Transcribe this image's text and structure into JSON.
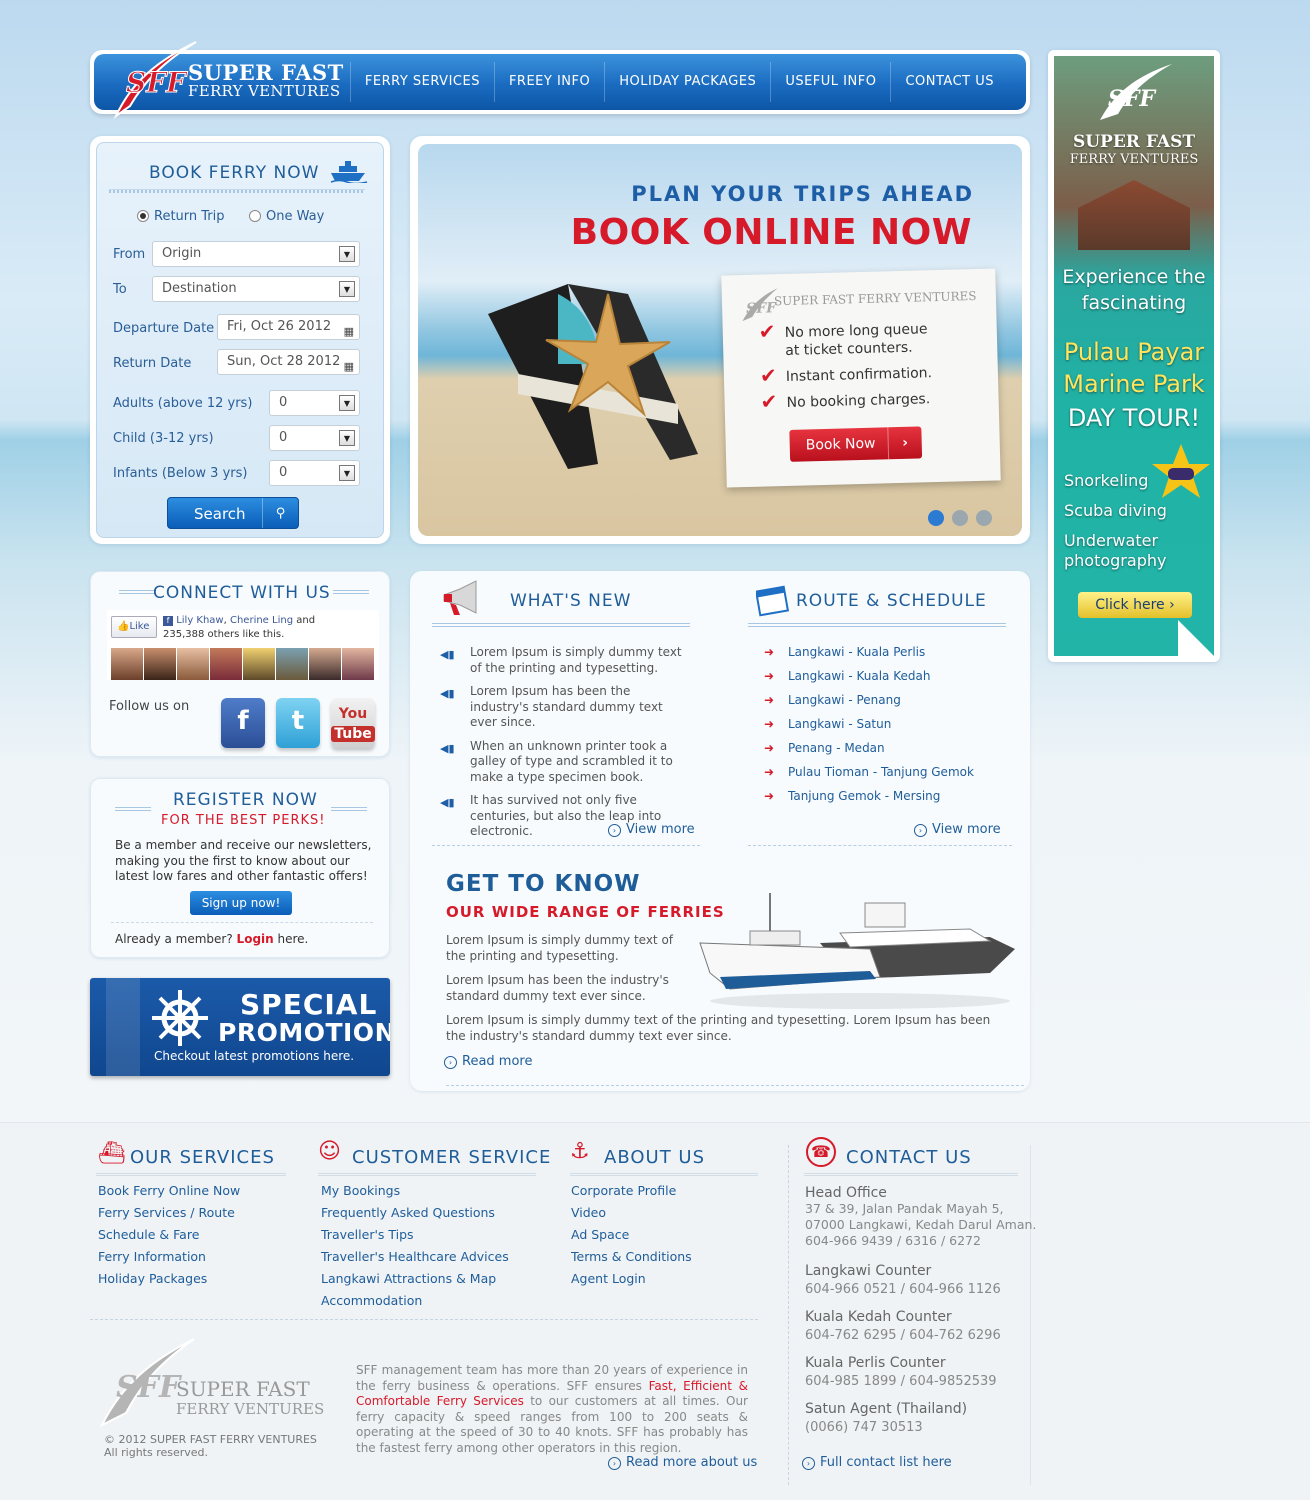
{
  "header": {
    "logo_mark": "SFF",
    "brand_line1": "SUPER FAST",
    "brand_line2": "FERRY VENTURES",
    "nav": [
      "FERRY SERVICES",
      "FREEY INFO",
      "HOLIDAY PACKAGES",
      "USEFUL INFO",
      "CONTACT US"
    ]
  },
  "booking": {
    "title": "BOOK FERRY NOW",
    "trip_type": {
      "return": "Return Trip",
      "oneway": "One Way",
      "selected": "return"
    },
    "from_label": "From",
    "from_value": "Origin",
    "to_label": "To",
    "to_value": "Destination",
    "departure_label": "Departure Date",
    "departure_value": "Fri, Oct 26 2012",
    "return_label": "Return Date",
    "return_value": "Sun, Oct 28 2012",
    "adults_label": "Adults (above 12 yrs)",
    "adults_value": "0",
    "child_label": "Child (3-12 yrs)",
    "child_value": "0",
    "infants_label": "Infants (Below 3 yrs)",
    "infants_value": "0",
    "search_label": "Search"
  },
  "hero": {
    "subtitle": "PLAN YOUR TRIPS AHEAD",
    "title": "BOOK ONLINE NOW",
    "card_brand": "SUPER FAST FERRY VENTURES",
    "card_mark": "SFF",
    "points": [
      "No more long queue at ticket counters.",
      "Instant confirmation.",
      "No booking charges."
    ],
    "button": "Book Now",
    "slides": 3,
    "active_slide": 1
  },
  "side_banner": {
    "brand_mark": "SFF",
    "brand_line1": "SUPER FAST",
    "brand_line2": "FERRY VENTURES",
    "line1": "Experience the",
    "line2": "fascinating",
    "line3": "Pulau Payar",
    "line4": "Marine Park",
    "line5": "DAY TOUR!",
    "activities": [
      "Snorkeling",
      "Scuba diving",
      "Underwater",
      "photography"
    ],
    "button": "Click here"
  },
  "connect": {
    "title": "CONNECT WITH US",
    "like": "Like",
    "fb_name1": "Lily Khaw",
    "fb_name2": "Cherine Ling",
    "fb_and": "and",
    "fb_text": "235,388 others like this.",
    "follow": "Follow us on"
  },
  "register": {
    "title": "REGISTER NOW",
    "subtitle": "FOR THE BEST PERKS!",
    "body": "Be a member and receive our newsletters, making you the first to know about our latest low fares and other fantastic offers!",
    "button": "Sign up now!",
    "member_text": "Already a member?",
    "login": "Login",
    "here": "here."
  },
  "promo": {
    "line1": "SPECIAL",
    "line2": "PROMOTION",
    "line3": "Checkout latest promotions here."
  },
  "whats_new": {
    "title": "WHAT'S NEW",
    "items": [
      "Lorem Ipsum is simply dummy text of the printing and typesetting.",
      "Lorem Ipsum has been the industry's standard dummy text ever since.",
      "When an unknown printer took a galley of type and scrambled it to make a type specimen book.",
      "It has survived not only five centuries, but also the leap into electronic."
    ],
    "view_more": "View more"
  },
  "route": {
    "title": "ROUTE & SCHEDULE",
    "items": [
      "Langkawi - Kuala Perlis",
      "Langkawi - Kuala Kedah",
      "Langkawi - Penang",
      "Langkawi - Satun",
      "Penang - Medan",
      "Pulau Tioman - Tanjung Gemok",
      "Tanjung Gemok - Mersing"
    ],
    "view_more": "View more"
  },
  "get_to_know": {
    "title": "GET TO KNOW",
    "subtitle": "OUR WIDE RANGE OF FERRIES",
    "p1": "Lorem Ipsum is simply dummy text of the printing and typesetting.",
    "p2": "Lorem Ipsum has been the industry's standard dummy text ever since.",
    "p3": "Lorem Ipsum is simply dummy text of the printing and typesetting. Lorem Ipsum has been the industry's standard dummy text ever since.",
    "read_more": "Read more"
  },
  "footer": {
    "services": {
      "title": "OUR SERVICES",
      "items": [
        "Book Ferry Online Now",
        "Ferry Services / Route",
        "Schedule & Fare",
        "Ferry Information",
        "Holiday Packages"
      ]
    },
    "customer": {
      "title": "CUSTOMER SERVICE",
      "items": [
        "My Bookings",
        "Frequently Asked Questions",
        "Traveller's Tips",
        "Traveller's Healthcare Advices",
        "Langkawi Attractions & Map",
        "Accommodation"
      ]
    },
    "about": {
      "title": "ABOUT US",
      "items": [
        "Corporate Profile",
        "Video",
        "Ad Space",
        "Terms & Conditions",
        "Agent Login"
      ]
    },
    "contact": {
      "title": "CONTACT US",
      "head_office": "Head Office",
      "address1": "37 & 39, Jalan Pandak Mayah 5,",
      "address2": "07000 Langkawi, Kedah Darul Aman.",
      "phone": "604-966 9439 / 6316 / 6272",
      "counters": [
        {
          "name": "Langkawi Counter",
          "phone": "604-966 0521 / 604-966 1126"
        },
        {
          "name": "Kuala Kedah Counter",
          "phone": "604-762 6295 / 604-762 6296"
        },
        {
          "name": "Kuala Perlis Counter",
          "phone": "604-985 1899 / 604-9852539"
        },
        {
          "name": "Satun Agent (Thailand)",
          "phone": "(0066) 747 30513"
        }
      ],
      "full_list": "Full contact list here"
    },
    "logo_mark": "SFF",
    "brand_line1": "SUPER FAST",
    "brand_line2": "FERRY VENTURES",
    "copyright": "© 2012 SUPER FAST FERRY VENTURES",
    "rights": "All rights reserved.",
    "about_pre": "SFF management team has more than 20 years of experience in the ferry business & operations. SFF ensures",
    "about_highlight": "Fast, Efficient & Comfortable Ferry Services",
    "about_post": "to our customers at all times. Our ferry capacity & speed ranges from 100 to 200 seats & operating at the speed of 30 to 40 knots. SFF has probably has the fastest ferry among other operators in this  region.",
    "read_more_about": "Read more about us"
  }
}
